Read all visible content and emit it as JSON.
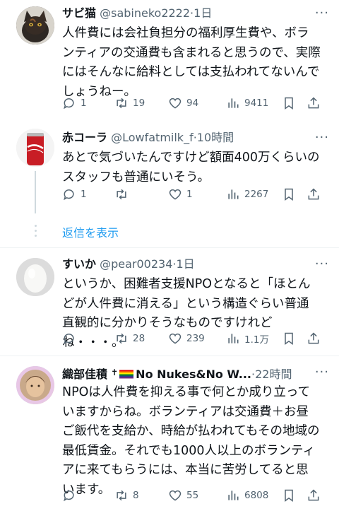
{
  "tweets": [
    {
      "name": "サビ猫",
      "handle": "@sabineko2222",
      "time": "1日",
      "text": "人件費には会社負担分の福利厚生費や、ボランティアの交通費も含まれると思うので、実際にはそんなに給料としては支払われてないんでしょうねー。",
      "replies": "1",
      "retweets": "19",
      "likes": "94",
      "views": "9411"
    },
    {
      "name": "赤コーラ",
      "handle": "@Lowfatmilk_f",
      "time": "10時間",
      "text": "あとで気づいたんですけど額面400万くらいのスタッフも普通にいそう。",
      "replies": "1",
      "retweets": "",
      "likes": "1",
      "views": "2267"
    },
    {
      "name": "すいか",
      "handle": "@pear00234",
      "time": "1日",
      "text": "というか、困難者支援NPOとなると「ほとんどが人件費に消える」という構造ぐらい普通直観的に分かりそうなものですけれどね・・・。",
      "replies": "",
      "retweets": "28",
      "likes": "239",
      "views": "1.1万"
    },
    {
      "name": "織部佳積",
      "name_suffix": "No Nukes&No W...",
      "cross": "✝",
      "time": "22時間",
      "text": "NPOは人件費を抑える事で何とか成り立っていますからね。ボランティアは交通費＋お昼ご飯代を支給か、時給が払われてもその地域の最低賃金。それでも1000人以上のボランティアに来てもらうには、本当に苦労してると思います。",
      "replies": "",
      "retweets": "8",
      "likes": "55",
      "views": "6808"
    }
  ],
  "show_replies_label": "返信を表示",
  "separator": "·",
  "more_label": "···",
  "colors": {
    "link": "#1d9bf0",
    "muted": "#536471",
    "divider": "#eff3f4"
  }
}
